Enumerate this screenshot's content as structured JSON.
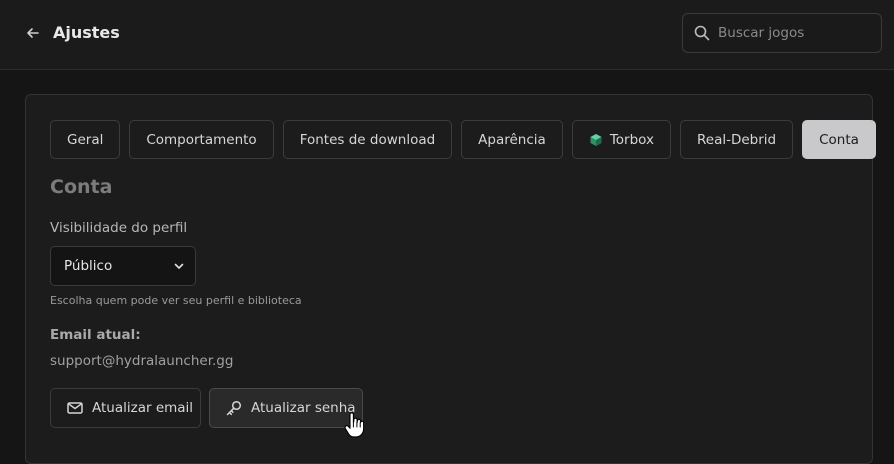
{
  "header": {
    "title": "Ajustes",
    "search_placeholder": "Buscar jogos"
  },
  "tabs": [
    {
      "label": "Geral",
      "active": false
    },
    {
      "label": "Comportamento",
      "active": false
    },
    {
      "label": "Fontes de download",
      "active": false
    },
    {
      "label": "Aparência",
      "active": false
    },
    {
      "label": "Torbox",
      "active": false,
      "icon": "torbox-icon"
    },
    {
      "label": "Real-Debrid",
      "active": false
    },
    {
      "label": "Conta",
      "active": true
    }
  ],
  "account": {
    "section_title": "Conta",
    "visibility_label": "Visibilidade do perfil",
    "visibility_value": "Público",
    "visibility_hint": "Escolha quem pode ver seu perfil e biblioteca",
    "email_label": "Email atual:",
    "email_value": "support@hydralauncher.gg",
    "update_email_label": "Atualizar email",
    "update_password_label": "Atualizar senha"
  },
  "colors": {
    "background": "#151515",
    "panel": "#1c1c1c",
    "active_tab": "#c9c9cc",
    "torbox_icon": "#3aa57a"
  }
}
